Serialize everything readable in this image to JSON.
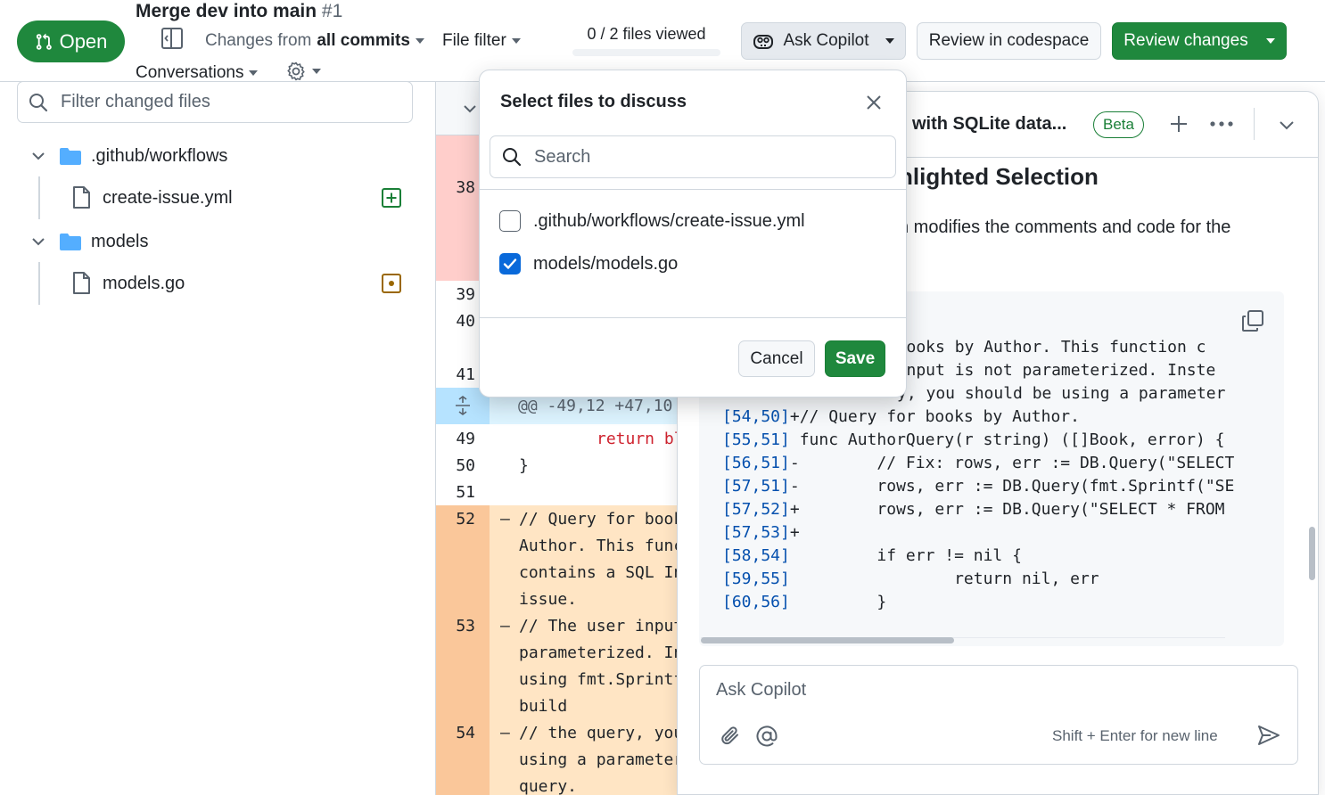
{
  "header": {
    "state_label": "Open",
    "pr_title": "Merge dev into main",
    "pr_number": "#1",
    "changes_prefix": "Changes from",
    "changes_value": "all commits",
    "file_filter_label": "File filter",
    "conversations_label": "Conversations",
    "files_viewed": "0 / 2 files viewed",
    "ask_copilot_label": "Ask Copilot",
    "codespace_label": "Review in codespace",
    "review_changes_label": "Review changes",
    "colors": {
      "green": "#1f883d",
      "border": "#d0d7de"
    }
  },
  "sidebar": {
    "filter_placeholder": "Filter changed files",
    "tree": [
      {
        "type": "folder",
        "label": ".github/workflows"
      },
      {
        "type": "file",
        "label": "create-issue.yml",
        "status": "added"
      },
      {
        "type": "folder",
        "label": "models"
      },
      {
        "type": "file",
        "label": "models.go",
        "status": "modified"
      }
    ],
    "colors": {
      "folder": "#54aeff",
      "added": "#1a7f37",
      "modified": "#9a6700"
    }
  },
  "diff": {
    "hunk": "@@ -49,12 +47,10",
    "lines": [
      {
        "num": "38",
        "code": ""
      },
      {
        "num": "39",
        "code": ""
      },
      {
        "num": "40",
        "code": ""
      },
      {
        "num": "41",
        "code": ""
      },
      {
        "num": "49",
        "code": "return bl"
      },
      {
        "num": "50",
        "code": "}"
      },
      {
        "num": "51",
        "code": ""
      },
      {
        "num": "52",
        "marker": "–",
        "code": [
          "// Query for book",
          "Author. This func",
          "contains a SQL In",
          "issue."
        ]
      },
      {
        "num": "53",
        "marker": "–",
        "code": [
          "// The user input",
          "parameterized. In",
          "using fmt.Sprintf",
          "build"
        ]
      },
      {
        "num": "54",
        "marker": "–",
        "code": [
          "// the query, you",
          "using a parameter",
          "query."
        ]
      }
    ],
    "colors": {
      "deleted_num": "#ffcecb",
      "deleted_line": "#ffd7b5",
      "hunk_bg": "#ddf4ff"
    }
  },
  "copilot": {
    "title_fragment": "with SQLite data...",
    "beta_label": "Beta",
    "heading_fragment": "hlighted Selection",
    "text_fragment": "n modifies the comments and code for the",
    "code_lines": [
      {
        "prefix": "",
        "text": "  books by Author. This function c"
      },
      {
        "prefix": "",
        "text": "  input is not parameterized. Inste"
      },
      {
        "prefix": "",
        "text": "y, you should be using a parameter"
      },
      {
        "prefix": "[54,50]",
        "text": "+// Query for books by Author."
      },
      {
        "prefix": "[55,51]",
        "text": " func AuthorQuery(r string) ([]Book, error) {"
      },
      {
        "prefix": "[56,51]",
        "text": "-        // Fix: rows, err := DB.Query(\"SELECT"
      },
      {
        "prefix": "[57,51]",
        "text": "-        rows, err := DB.Query(fmt.Sprintf(\"SE"
      },
      {
        "prefix": "[57,52]",
        "text": "+        rows, err := DB.Query(\"SELECT * FROM"
      },
      {
        "prefix": "[57,53]",
        "text": "+"
      },
      {
        "prefix": "[58,54]",
        "text": "         if err != nil {"
      },
      {
        "prefix": "[59,55]",
        "text": "                 return nil, err"
      },
      {
        "prefix": "[60,56]",
        "text": "         }"
      }
    ],
    "ask_placeholder": "Ask Copilot",
    "shift_hint": "Shift + Enter for new line"
  },
  "modal": {
    "title": "Select files to discuss",
    "search_placeholder": "Search",
    "files": [
      {
        "label": ".github/workflows/create-issue.yml",
        "checked": false
      },
      {
        "label": "models/models.go",
        "checked": true
      }
    ],
    "cancel_label": "Cancel",
    "save_label": "Save",
    "colors": {
      "check": "#0969da",
      "save": "#1f883d"
    }
  }
}
